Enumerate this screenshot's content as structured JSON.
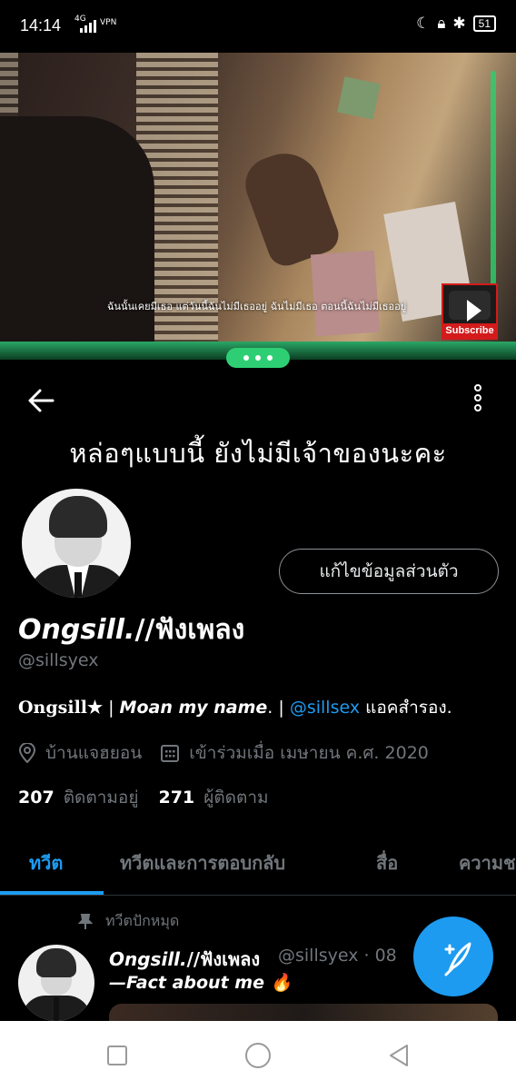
{
  "status_bar": {
    "time": "14:14",
    "network": "4G",
    "vpn": "VPN",
    "battery": "51"
  },
  "video": {
    "subtitle": "ฉันนั้นเคยมีเธอ แต่วันนี้ฉันไม่มีเธออยู่ ฉันไม่มีเธอ ตอนนี้ฉันไม่มีเธออยู่",
    "subscribe_label": "Subscribe"
  },
  "profile": {
    "headline": "หล่อๆแบบนี้ ยังไม่มีเจ้าของนะคะ",
    "edit_button": "แก้ไขข้อมูลส่วนตัว",
    "display_name_latin": "Ongsill.",
    "display_name_rest": "//ฟังเพลง",
    "handle": "@sillsyex",
    "bio": {
      "part1": "Ongsill★",
      "sep1": " | ",
      "part2": "Moan my name",
      "sep2": ". | ",
      "mention": "@sillsex",
      "part3": " แอคสำรอง."
    },
    "location": "บ้านแจฮยอน",
    "joined": "เข้าร่วมเมื่อ เมษายน ค.ศ. 2020",
    "following_count": "207",
    "following_label": "ติดตามอยู่",
    "followers_count": "271",
    "followers_label": "ผู้ติดตาม"
  },
  "tabs": [
    {
      "label": "ทวีต",
      "active": true
    },
    {
      "label": "ทวีตและการตอบกลับ",
      "active": false
    },
    {
      "label": "สื่อ",
      "active": false
    },
    {
      "label": "ความช",
      "active": false
    }
  ],
  "tweet": {
    "pinned_label": "ทวีตปักหมุด",
    "name_latin": "Ongsill.",
    "name_rest": "//ฟังเพลง",
    "handle": "@sillsyex · 08",
    "text": "—Fact about me 🔥"
  },
  "colors": {
    "accent": "#1d9bf0",
    "background": "#000000",
    "green": "#2ecf74",
    "subscribe_red": "#d31b1b"
  },
  "icons": [
    "back-arrow-icon",
    "more-vertical-icon",
    "location-icon",
    "calendar-icon",
    "pin-icon",
    "compose-icon",
    "nav-recents-icon",
    "nav-home-icon",
    "nav-back-icon"
  ]
}
